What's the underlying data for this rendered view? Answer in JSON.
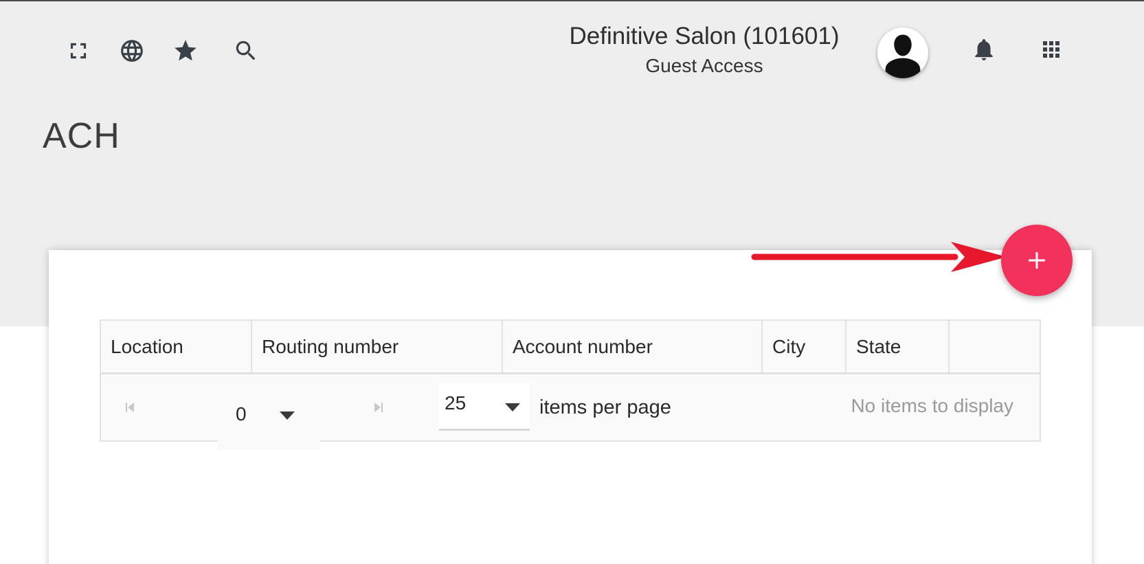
{
  "header": {
    "account_name": "Definitive Salon (101601)",
    "account_subtitle": "Guest Access",
    "icons": [
      "fullscreen-icon",
      "globe-icon",
      "star-icon",
      "search-icon",
      "avatar-icon",
      "bell-icon",
      "apps-grid-icon"
    ]
  },
  "page": {
    "title": "ACH"
  },
  "fab": {
    "label": "+",
    "color": "#f2325a"
  },
  "annotation": {
    "arrow_color": "#e8182c"
  },
  "grid": {
    "columns": [
      "Location",
      "Routing number",
      "Account number",
      "City",
      "State",
      ""
    ],
    "rows": []
  },
  "pager": {
    "current_page": "0",
    "page_size": "25",
    "items_per_page_label": "items per page",
    "info": "No items to display"
  }
}
